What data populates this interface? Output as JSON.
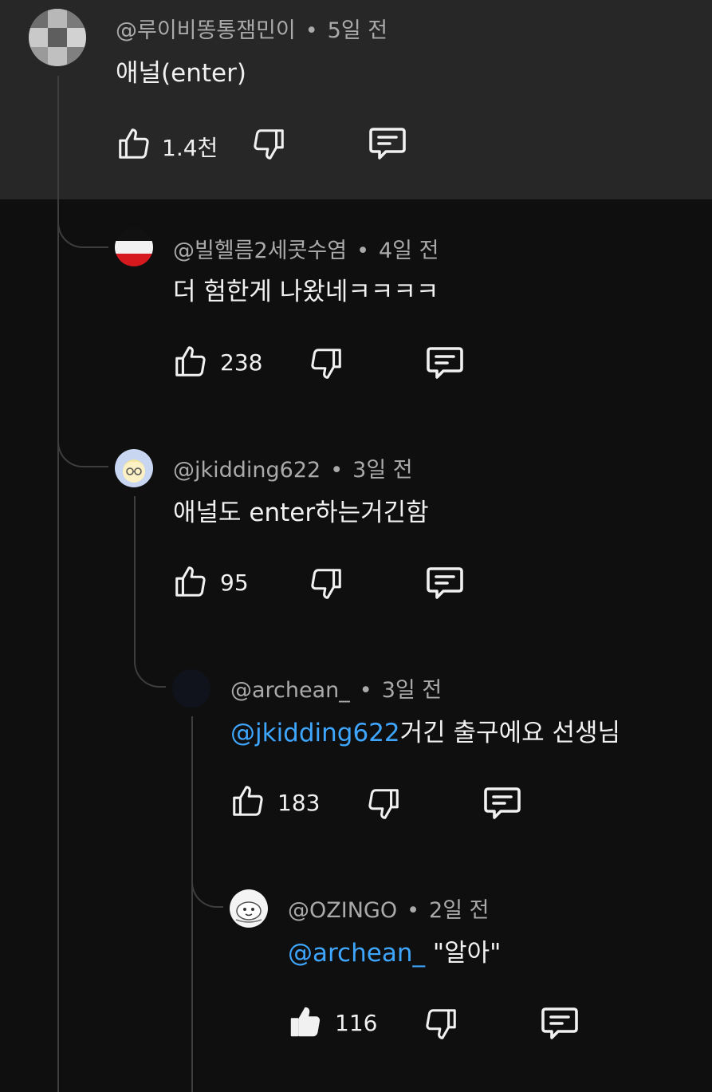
{
  "comments": [
    {
      "author": "@루이비똥통잼민이",
      "time": "5일 전",
      "text": "애널(enter)",
      "likes": "1.4천",
      "avatar_icon": "pixelated-avatar-icon"
    },
    {
      "author": "@빌헬름2세콧수염",
      "time": "4일 전",
      "text": "더 험한게 나왔네ㅋㅋㅋㅋ",
      "likes": "238",
      "avatar_icon": "flag-avatar-icon"
    },
    {
      "author": "@jkidding622",
      "time": "3일 전",
      "text": "애널도 enter하는거긴함",
      "likes": "95",
      "avatar_icon": "cartoon-avatar-icon"
    },
    {
      "author": "@archean_",
      "time": "3일 전",
      "mention": "@jkidding622",
      "text": "거긴 출구에요 선생님",
      "likes": "183",
      "avatar_icon": "dark-avatar-icon"
    },
    {
      "author": "@OZINGO",
      "time": "2일 전",
      "mention": "@archean_",
      "text": " \"알아\"",
      "likes": "116",
      "liked": true,
      "avatar_icon": "mascot-avatar-icon"
    }
  ],
  "dot": "•",
  "colors": {
    "background": "#0f0f0f",
    "highlight_background": "#272727",
    "text": "#f1f1f1",
    "meta_text": "#aaaaaa",
    "mention": "#3ea6ff",
    "thread_line": "#3e3e3e"
  }
}
